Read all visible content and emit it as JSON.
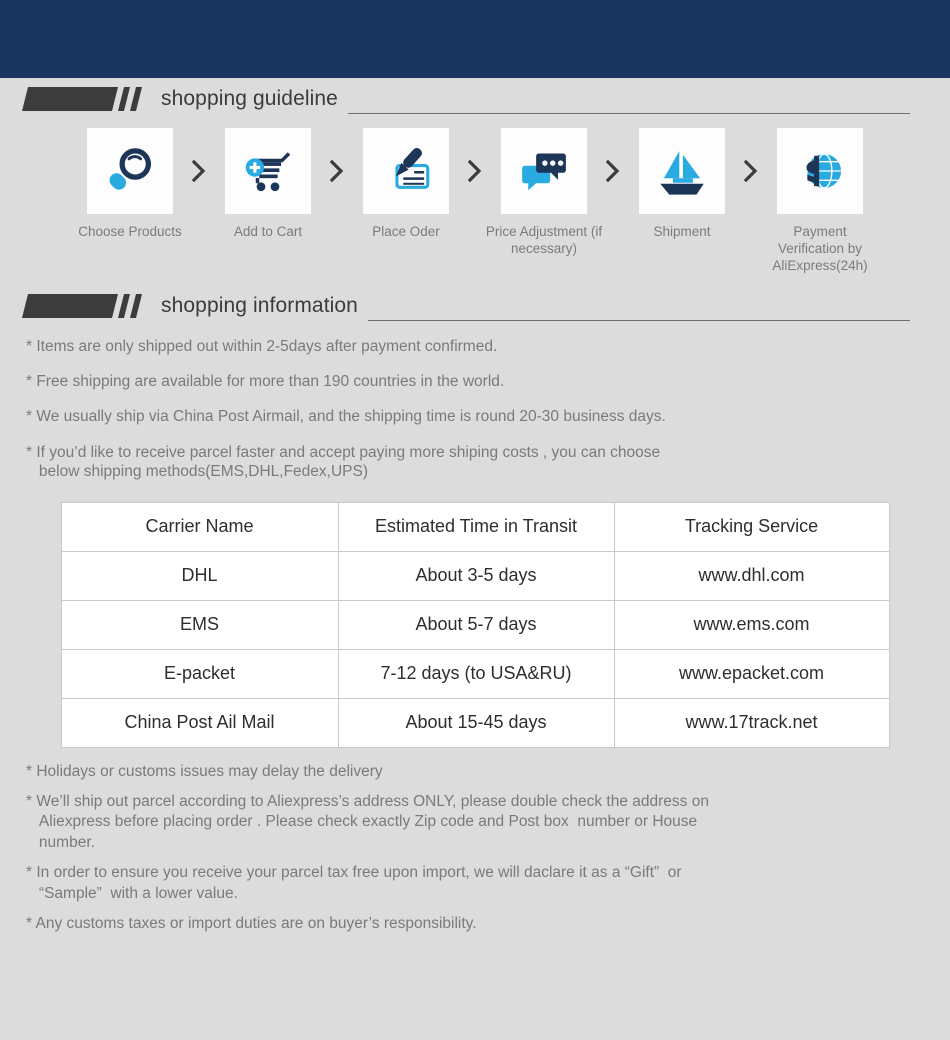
{
  "theme": {
    "banner_navy": "#1a3460",
    "page_bg": "#dcdcdc",
    "accent_dark_navy": "#1d3557",
    "accent_blue": "#29abe2",
    "text_gray": "#7a7a7a",
    "header_dark": "#3b3b3b"
  },
  "sections": {
    "guideline": {
      "title": "shopping guideline"
    },
    "information": {
      "title": "shopping information"
    }
  },
  "steps": [
    {
      "icon": "magnifier-icon",
      "label": "Choose Products"
    },
    {
      "icon": "cart-plus-icon",
      "label": "Add to Cart"
    },
    {
      "icon": "sign-check-icon",
      "label": "Place Oder"
    },
    {
      "icon": "chat-bubbles-icon",
      "label": "Price Adjustment\n(if necessary)"
    },
    {
      "icon": "sailboat-icon",
      "label": "Shipment"
    },
    {
      "icon": "dollar-globe-icon",
      "label": "Payment Verification\nby AliExpress(24h)"
    }
  ],
  "step_separator": "chevron-right-icon",
  "info_lines": [
    "* Items are only shipped out within 2-5days after payment confirmed.",
    "* Free shipping are available for more than 190 countries in the world.",
    "* We usually ship via China Post Airmail, and the shipping time is round 20-30 business days.",
    "* If you’d like to receive parcel faster and accept paying more shiping costs , you can choose\n   below shipping methods(EMS,DHL,Fedex,UPS)"
  ],
  "shipping_table": {
    "headers": [
      "Carrier Name",
      "Estimated Time in Transit",
      "Tracking Service"
    ],
    "rows": [
      [
        "DHL",
        "About 3-5 days",
        "www.dhl.com"
      ],
      [
        "EMS",
        "About 5-7 days",
        "www.ems.com"
      ],
      [
        "E-packet",
        "7-12 days (to USA&RU)",
        "www.epacket.com"
      ],
      [
        "China Post Ail Mail",
        "About 15-45 days",
        "www.17track.net"
      ]
    ]
  },
  "notes": [
    "* Holidays or customs issues may delay the delivery",
    "* We’ll ship out parcel according to Aliexpress’s address ONLY, please double check the address on\n   Aliexpress before placing order . Please check exactly Zip code and Post box  number or House\n   number.",
    "* In order to ensure you receive your parcel tax free upon import, we will daclare it as a “Gift”  or\n   “Sample”  with a lower value.",
    "* Any customs taxes or import duties are on buyer’s responsibility."
  ]
}
